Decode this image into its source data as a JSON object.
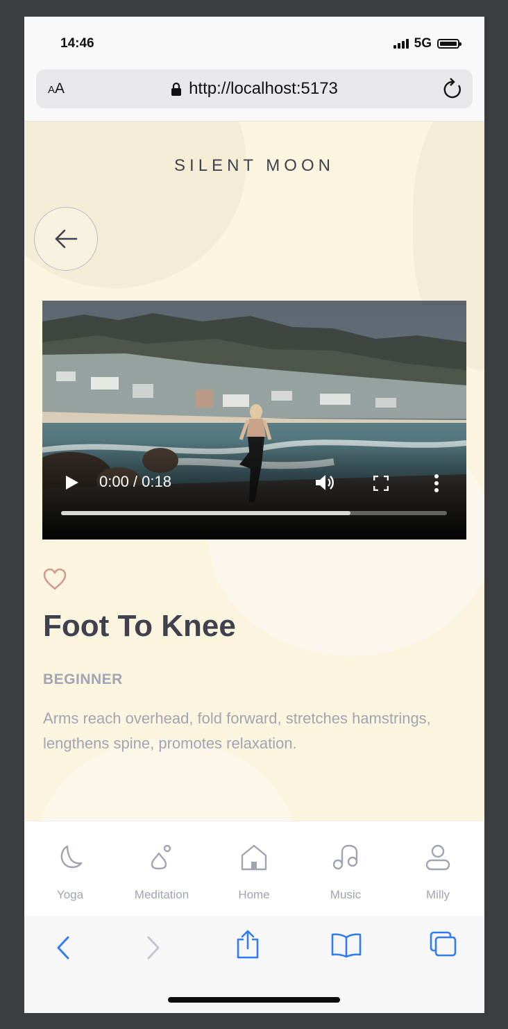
{
  "status": {
    "time": "14:46",
    "network": "5G"
  },
  "browser": {
    "aa_small": "A",
    "aa_large": "A",
    "url": "http://localhost:5173"
  },
  "app": {
    "brand": "SILENT  MOON"
  },
  "video": {
    "current_time": "0:00",
    "duration": "0:18",
    "time_display": "0:00 / 0:18",
    "progress_fraction": 0.75
  },
  "exercise": {
    "title": "Foot To Knee",
    "level": "BEGINNER",
    "description": "Arms reach overhead, fold forward, stretches hamstrings, lengthens spine, promotes relaxation."
  },
  "tabs": [
    {
      "label": "Yoga",
      "icon": "moon-icon"
    },
    {
      "label": "Meditation",
      "icon": "meditation-icon"
    },
    {
      "label": "Home",
      "icon": "home-icon"
    },
    {
      "label": "Music",
      "icon": "music-icon"
    },
    {
      "label": "Milly",
      "icon": "user-icon"
    }
  ],
  "colors": {
    "background": "#fbf4de",
    "text_dark": "#3f414e",
    "text_muted": "#a1a4b2",
    "heart": "#d29a8c",
    "safari_blue": "#2f7bf5"
  }
}
